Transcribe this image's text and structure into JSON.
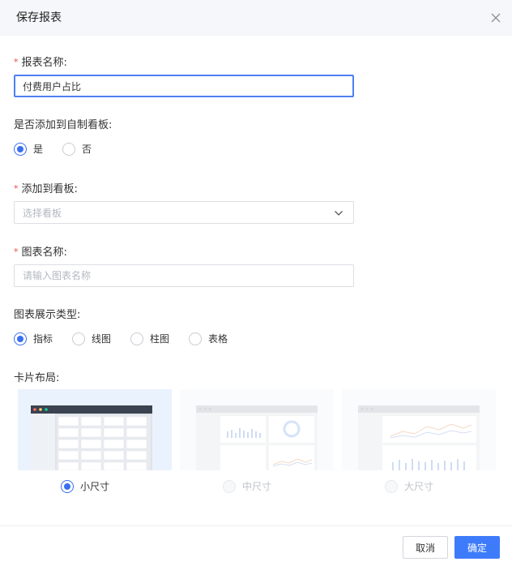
{
  "dialog": {
    "title": "保存报表",
    "close_icon": "close-icon"
  },
  "report_name": {
    "label": "报表名称:",
    "value": "付费用户占比",
    "required": true
  },
  "add_to_board": {
    "label": "是否添加到自制看板:",
    "options": [
      {
        "label": "是",
        "selected": true
      },
      {
        "label": "否",
        "selected": false
      }
    ]
  },
  "board": {
    "label": "添加到看板:",
    "placeholder": "选择看板",
    "required": true,
    "icon": "chevron-down-icon"
  },
  "chart_name": {
    "label": "图表名称:",
    "placeholder": "请输入图表名称",
    "required": true
  },
  "chart_type": {
    "label": "图表展示类型:",
    "options": [
      {
        "label": "指标",
        "selected": true
      },
      {
        "label": "线图",
        "selected": false
      },
      {
        "label": "柱图",
        "selected": false
      },
      {
        "label": "表格",
        "selected": false
      }
    ]
  },
  "card_layout": {
    "label": "卡片布局:",
    "options": [
      {
        "label": "小尺寸",
        "selected": true,
        "disabled": false
      },
      {
        "label": "中尺寸",
        "selected": false,
        "disabled": true
      },
      {
        "label": "大尺寸",
        "selected": false,
        "disabled": true
      }
    ]
  },
  "footer": {
    "cancel_label": "取消",
    "confirm_label": "确定"
  },
  "colors": {
    "primary": "#3e7bfa",
    "required": "#f04848",
    "header_bg": "#f6f7fa",
    "selected_card_bg": "#eaf2fe"
  }
}
